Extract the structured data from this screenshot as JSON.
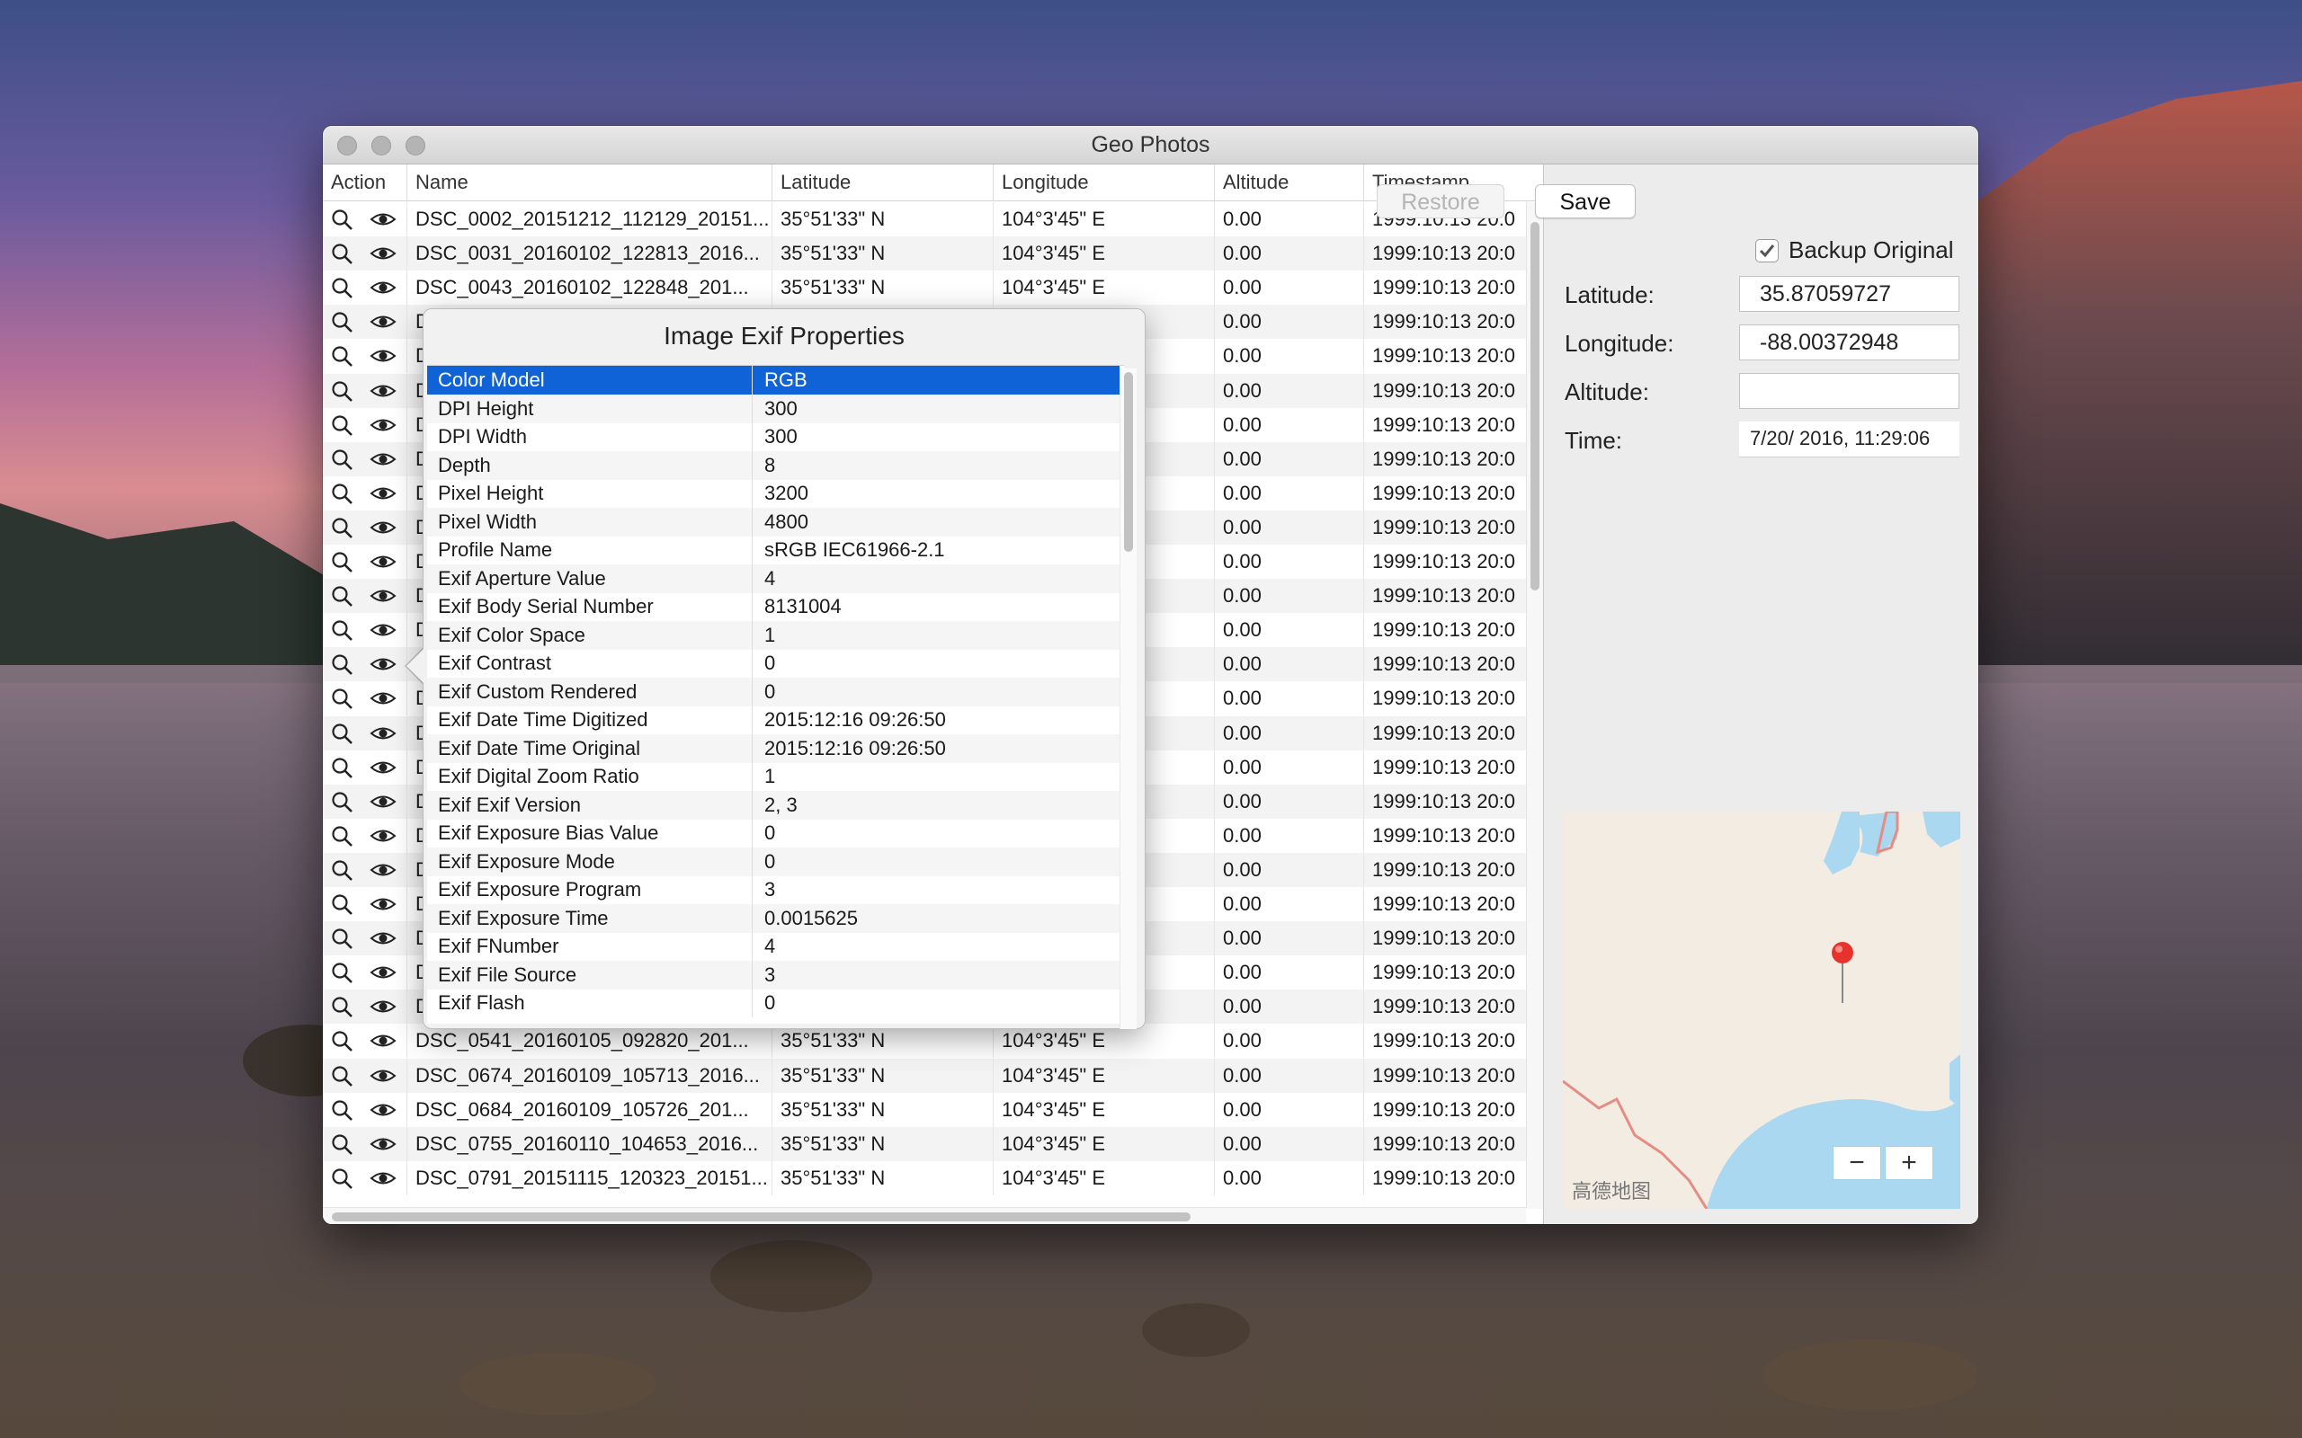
{
  "window": {
    "title": "Geo Photos"
  },
  "table": {
    "columns": {
      "action": "Action",
      "name": "Name",
      "latitude": "Latitude",
      "longitude": "Longitude",
      "altitude": "Altitude",
      "timestamp": "Timestamp"
    },
    "rows": [
      {
        "name": "DSC_0002_20151212_112129_20151...",
        "lat": "35°51'33\" N",
        "lon": "104°3'45\" E",
        "alt": "0.00",
        "ts": "1999:10:13 20:0"
      },
      {
        "name": "DSC_0031_20160102_122813_2016...",
        "lat": "35°51'33\" N",
        "lon": "104°3'45\" E",
        "alt": "0.00",
        "ts": "1999:10:13 20:0"
      },
      {
        "name": "DSC_0043_20160102_122848_201...",
        "lat": "35°51'33\" N",
        "lon": "104°3'45\" E",
        "alt": "0.00",
        "ts": "1999:10:13 20:0"
      },
      {
        "name": "D",
        "lat": "",
        "lon": "",
        "alt": "0.00",
        "ts": "1999:10:13 20:0"
      },
      {
        "name": "D",
        "lat": "",
        "lon": "",
        "alt": "0.00",
        "ts": "1999:10:13 20:0"
      },
      {
        "name": "D",
        "lat": "",
        "lon": "",
        "alt": "0.00",
        "ts": "1999:10:13 20:0"
      },
      {
        "name": "D",
        "lat": "",
        "lon": "",
        "alt": "0.00",
        "ts": "1999:10:13 20:0"
      },
      {
        "name": "D",
        "lat": "",
        "lon": "",
        "alt": "0.00",
        "ts": "1999:10:13 20:0"
      },
      {
        "name": "D",
        "lat": "",
        "lon": "",
        "alt": "0.00",
        "ts": "1999:10:13 20:0"
      },
      {
        "name": "D",
        "lat": "",
        "lon": "",
        "alt": "0.00",
        "ts": "1999:10:13 20:0"
      },
      {
        "name": "D",
        "lat": "",
        "lon": "",
        "alt": "0.00",
        "ts": "1999:10:13 20:0"
      },
      {
        "name": "D",
        "lat": "",
        "lon": "",
        "alt": "0.00",
        "ts": "1999:10:13 20:0"
      },
      {
        "name": "D",
        "lat": "",
        "lon": "",
        "alt": "0.00",
        "ts": "1999:10:13 20:0"
      },
      {
        "name": "",
        "lat": "",
        "lon": "",
        "alt": "0.00",
        "ts": "1999:10:13 20:0"
      },
      {
        "name": "D",
        "lat": "",
        "lon": "",
        "alt": "0.00",
        "ts": "1999:10:13 20:0"
      },
      {
        "name": "D",
        "lat": "",
        "lon": "",
        "alt": "0.00",
        "ts": "1999:10:13 20:0"
      },
      {
        "name": "D",
        "lat": "",
        "lon": "",
        "alt": "0.00",
        "ts": "1999:10:13 20:0"
      },
      {
        "name": "D",
        "lat": "",
        "lon": "",
        "alt": "0.00",
        "ts": "1999:10:13 20:0"
      },
      {
        "name": "D",
        "lat": "",
        "lon": "",
        "alt": "0.00",
        "ts": "1999:10:13 20:0"
      },
      {
        "name": "D",
        "lat": "",
        "lon": "",
        "alt": "0.00",
        "ts": "1999:10:13 20:0"
      },
      {
        "name": "D",
        "lat": "",
        "lon": "",
        "alt": "0.00",
        "ts": "1999:10:13 20:0"
      },
      {
        "name": "D",
        "lat": "",
        "lon": "",
        "alt": "0.00",
        "ts": "1999:10:13 20:0"
      },
      {
        "name": "D",
        "lat": "",
        "lon": "",
        "alt": "0.00",
        "ts": "1999:10:13 20:0"
      },
      {
        "name": "D",
        "lat": "",
        "lon": "",
        "alt": "0.00",
        "ts": "1999:10:13 20:0"
      },
      {
        "name": "DSC_0541_20160105_092820_201...",
        "lat": "35°51'33\" N",
        "lon": "104°3'45\" E",
        "alt": "0.00",
        "ts": "1999:10:13 20:0"
      },
      {
        "name": "DSC_0674_20160109_105713_2016...",
        "lat": "35°51'33\" N",
        "lon": "104°3'45\" E",
        "alt": "0.00",
        "ts": "1999:10:13 20:0"
      },
      {
        "name": "DSC_0684_20160109_105726_201...",
        "lat": "35°51'33\" N",
        "lon": "104°3'45\" E",
        "alt": "0.00",
        "ts": "1999:10:13 20:0"
      },
      {
        "name": "DSC_0755_20160110_104653_2016...",
        "lat": "35°51'33\" N",
        "lon": "104°3'45\" E",
        "alt": "0.00",
        "ts": "1999:10:13 20:0"
      },
      {
        "name": "DSC_0791_20151115_120323_20151...",
        "lat": "35°51'33\" N",
        "lon": "104°3'45\" E",
        "alt": "0.00",
        "ts": "1999:10:13 20:0"
      }
    ]
  },
  "popover": {
    "title": "Image Exif Properties",
    "rows": [
      {
        "key": "Color Model",
        "value": "RGB"
      },
      {
        "key": "DPI Height",
        "value": "300"
      },
      {
        "key": "DPI Width",
        "value": "300"
      },
      {
        "key": "Depth",
        "value": "8"
      },
      {
        "key": "Pixel Height",
        "value": "3200"
      },
      {
        "key": "Pixel Width",
        "value": "4800"
      },
      {
        "key": "Profile Name",
        "value": "sRGB IEC61966-2.1"
      },
      {
        "key": "Exif  Aperture Value",
        "value": "4"
      },
      {
        "key": "Exif  Body Serial Number",
        "value": "8131004"
      },
      {
        "key": "Exif  Color Space",
        "value": "1"
      },
      {
        "key": "Exif  Contrast",
        "value": "0"
      },
      {
        "key": "Exif  Custom Rendered",
        "value": "0"
      },
      {
        "key": "Exif  Date Time Digitized",
        "value": "2015:12:16 09:26:50"
      },
      {
        "key": "Exif  Date Time Original",
        "value": "2015:12:16 09:26:50"
      },
      {
        "key": "Exif  Digital Zoom Ratio",
        "value": "1"
      },
      {
        "key": "Exif  Exif Version",
        "value": "2, 3"
      },
      {
        "key": "Exif  Exposure Bias Value",
        "value": "0"
      },
      {
        "key": "Exif  Exposure Mode",
        "value": "0"
      },
      {
        "key": "Exif  Exposure Program",
        "value": "3"
      },
      {
        "key": "Exif  Exposure Time",
        "value": "0.0015625"
      },
      {
        "key": "Exif  FNumber",
        "value": "4"
      },
      {
        "key": "Exif  File Source",
        "value": "3"
      },
      {
        "key": "Exif  Flash",
        "value": "0"
      }
    ]
  },
  "side": {
    "restore_label": "Restore",
    "save_label": "Save",
    "backup_label": "Backup Original",
    "backup_checked": true,
    "latitude_label": "Latitude:",
    "latitude_value": "35.87059727",
    "longitude_label": "Longitude:",
    "longitude_value": "-88.00372948",
    "altitude_label": "Altitude:",
    "altitude_value": "",
    "time_label": "Time:",
    "time_value": "7/20/ 2016,  11:29:06",
    "map_attribution": "高德地图",
    "zoom_out_label": "−",
    "zoom_in_label": "+"
  },
  "colors": {
    "selection": "#0f63d6",
    "map_water": "#a9d8f0",
    "map_land": "#f3ece3",
    "pin": "#e8322e"
  },
  "icons": {
    "action_search": "search-icon",
    "action_view": "eye-icon",
    "checkbox": "checkmark-icon",
    "map_pin": "map-pin-icon"
  }
}
